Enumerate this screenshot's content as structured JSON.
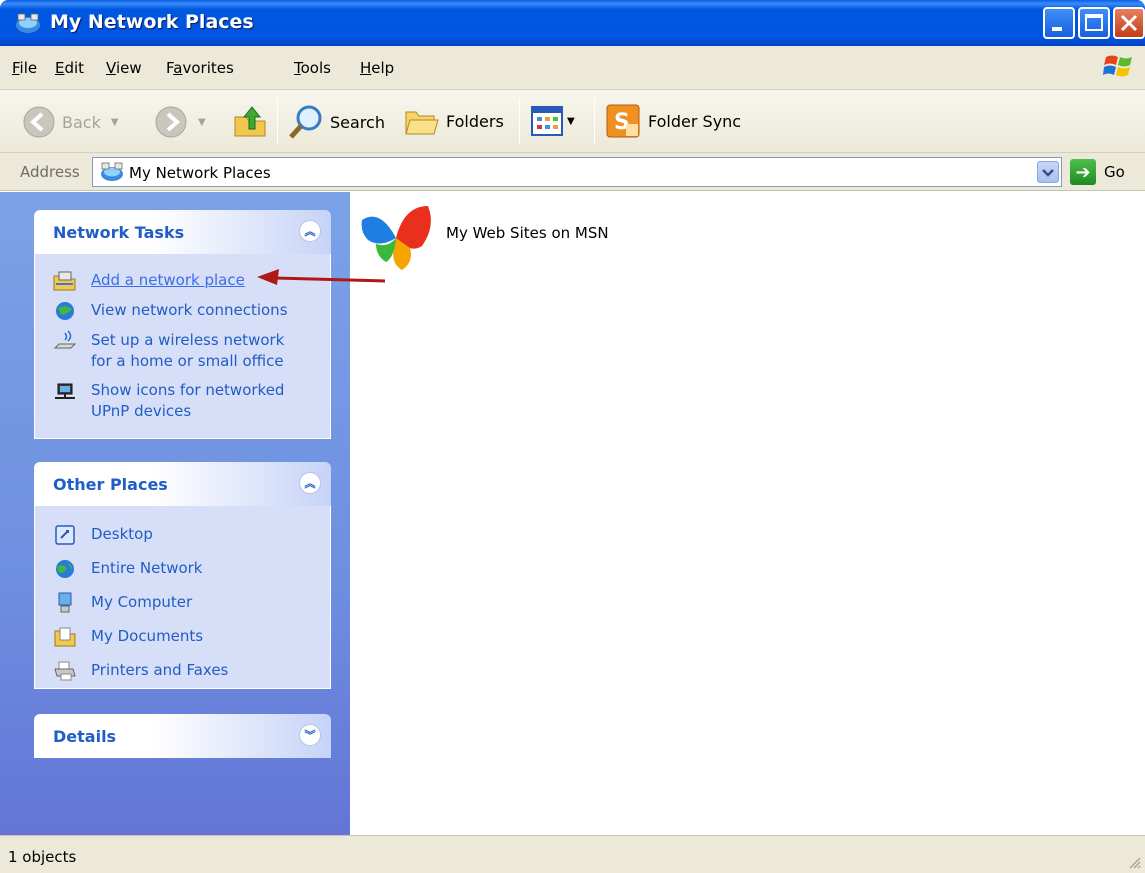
{
  "window": {
    "title": "My Network Places"
  },
  "menu": {
    "items": [
      {
        "label": "File",
        "key": "F",
        "rest": "ile"
      },
      {
        "label": "Edit",
        "key": "E",
        "rest": "dit"
      },
      {
        "label": "View",
        "key": "V",
        "rest": "iew"
      },
      {
        "label": "Favorites",
        "pre": "F",
        "key": "a",
        "rest": "vorites"
      },
      {
        "label": "Tools",
        "key": "T",
        "rest": "ools"
      },
      {
        "label": "Help",
        "key": "H",
        "rest": "elp"
      }
    ]
  },
  "toolbar": {
    "back_label": "Back",
    "search_label": "Search",
    "folders_label": "Folders",
    "folder_sync_label": "Folder Sync"
  },
  "address": {
    "label": "Address",
    "value": "My Network Places",
    "go_label": "Go"
  },
  "network_tasks": {
    "title": "Network Tasks",
    "items": [
      {
        "label": "Add a network place"
      },
      {
        "label": "View network connections"
      },
      {
        "label": "Set up a wireless network for a home or small office"
      },
      {
        "label": "Show icons for networked UPnP devices"
      }
    ]
  },
  "other_places": {
    "title": "Other Places",
    "items": [
      {
        "label": "Desktop"
      },
      {
        "label": "Entire Network"
      },
      {
        "label": "My Computer"
      },
      {
        "label": "My Documents"
      },
      {
        "label": "Printers and Faxes"
      }
    ]
  },
  "details": {
    "title": "Details"
  },
  "content": {
    "items": [
      {
        "label": "My Web Sites on MSN"
      }
    ]
  },
  "status": {
    "text": "1 objects"
  },
  "colors": {
    "title_bar": "#0055e3",
    "task_link": "#215dc6",
    "left_pane": "#7ba2e7",
    "annotation_arrow": "#b01818"
  }
}
